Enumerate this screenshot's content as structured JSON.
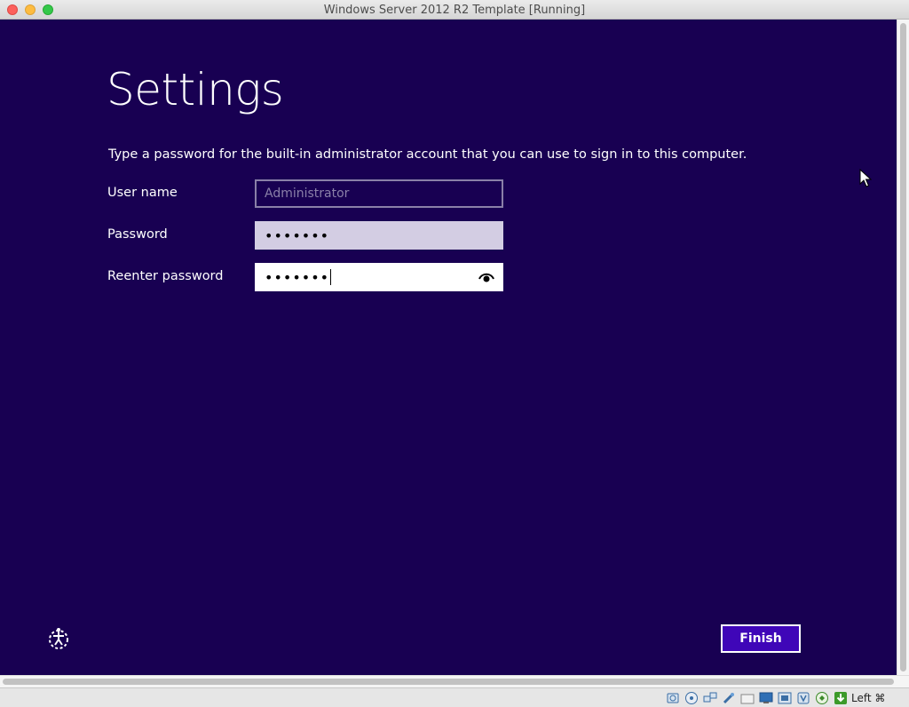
{
  "window": {
    "title": "Windows Server 2012 R2 Template [Running]"
  },
  "setup": {
    "heading": "Settings",
    "instructions": "Type a password for the built-in administrator account that you can use to sign in to this computer.",
    "fields": {
      "username": {
        "label": "User name",
        "placeholder": "Administrator"
      },
      "password": {
        "label": "Password",
        "masked_value": "•••••••"
      },
      "reenter": {
        "label": "Reenter password",
        "masked_value": "•••••••"
      }
    },
    "finish_label": "Finish"
  },
  "statusbar": {
    "icons": [
      "hard-disk-icon",
      "optical-drive-icon",
      "network-icon",
      "usb-icon",
      "shared-folders-icon",
      "display-icon",
      "video-capture-icon",
      "recording-icon",
      "mouse-integration-icon",
      "keyboard-capture-icon"
    ],
    "host_key": "Left ⌘"
  },
  "colors": {
    "screen_background": "#180052",
    "finish_button": "#3f06b8"
  }
}
